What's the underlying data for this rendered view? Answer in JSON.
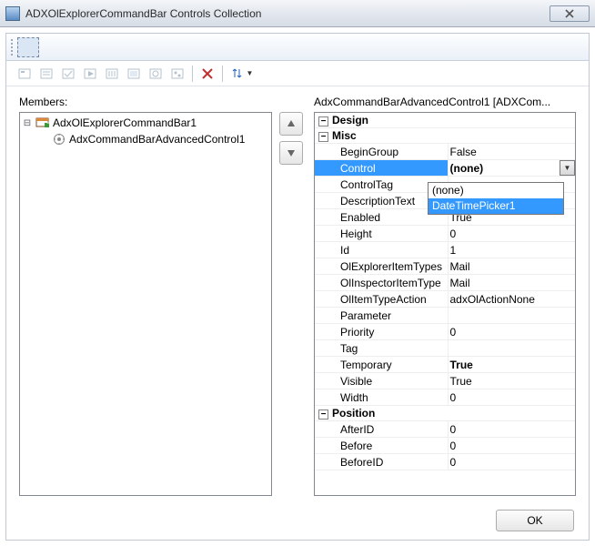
{
  "window": {
    "title": "ADXOlExplorerCommandBar Controls Collection"
  },
  "toolbar": {
    "icons": [
      "ctrl-1",
      "ctrl-2",
      "ctrl-3",
      "ctrl-4",
      "ctrl-5",
      "ctrl-6",
      "ctrl-7",
      "ctrl-8",
      "delete",
      "sort"
    ]
  },
  "left": {
    "label": "Members:",
    "tree": {
      "root": {
        "label": "AdxOlExplorerCommandBar1",
        "children": [
          {
            "label": "AdxCommandBarAdvancedControl1"
          }
        ]
      }
    }
  },
  "right": {
    "label": "AdxCommandBarAdvancedControl1 [ADXCom...",
    "categories": [
      {
        "name": "Design",
        "items": []
      },
      {
        "name": "Misc",
        "items": [
          {
            "name": "BeginGroup",
            "value": "False",
            "bold": false
          },
          {
            "name": "Control",
            "value": "(none)",
            "bold": true,
            "selected": true,
            "dropdown": true
          },
          {
            "name": "ControlTag",
            "value": "",
            "bold": false
          },
          {
            "name": "DescriptionText",
            "value": "",
            "bold": false
          },
          {
            "name": "Enabled",
            "value": "True",
            "bold": false,
            "hidden_by_dropdown": true
          },
          {
            "name": "Height",
            "value": "0",
            "bold": false
          },
          {
            "name": "Id",
            "value": "1",
            "bold": false
          },
          {
            "name": "OlExplorerItemTypes",
            "value": "Mail",
            "bold": false
          },
          {
            "name": "OlInspectorItemType",
            "value": "Mail",
            "bold": false
          },
          {
            "name": "OlItemTypeAction",
            "value": "adxOlActionNone",
            "bold": false
          },
          {
            "name": "Parameter",
            "value": "",
            "bold": false
          },
          {
            "name": "Priority",
            "value": "0",
            "bold": false
          },
          {
            "name": "Tag",
            "value": "",
            "bold": false
          },
          {
            "name": "Temporary",
            "value": "True",
            "bold": true
          },
          {
            "name": "Visible",
            "value": "True",
            "bold": false
          },
          {
            "name": "Width",
            "value": "0",
            "bold": false
          }
        ]
      },
      {
        "name": "Position",
        "items": [
          {
            "name": "AfterID",
            "value": "0",
            "bold": false
          },
          {
            "name": "Before",
            "value": "0",
            "bold": false
          },
          {
            "name": "BeforeID",
            "value": "0",
            "bold": false
          }
        ]
      }
    ],
    "dropdown_options": [
      {
        "label": "(none)",
        "selected": false
      },
      {
        "label": "DateTimePicker1",
        "selected": true
      }
    ]
  },
  "footer": {
    "ok": "OK"
  }
}
